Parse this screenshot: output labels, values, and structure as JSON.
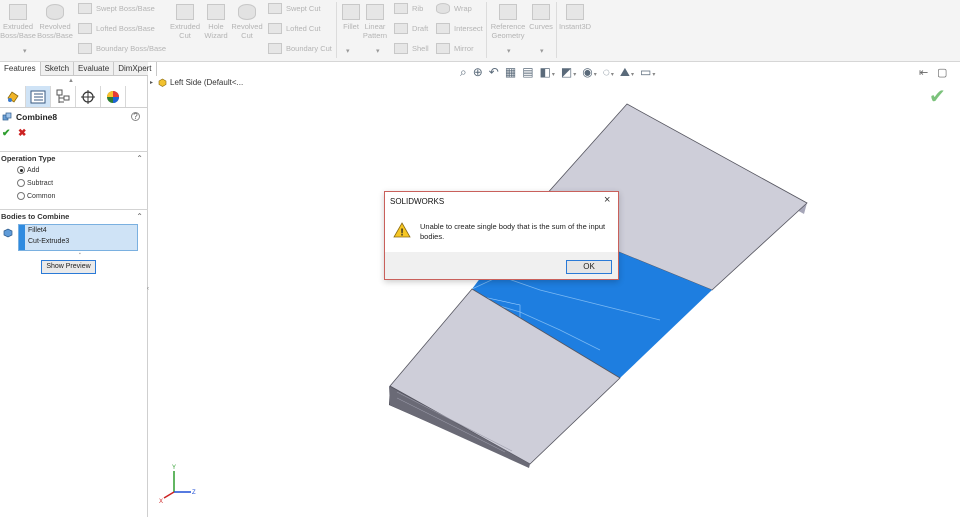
{
  "ribbon": {
    "extruded_boss": "Extruded\nBoss/Base",
    "revolved_boss": "Revolved\nBoss/Base",
    "swept_boss": "Swept Boss/Base",
    "lofted_boss": "Lofted Boss/Base",
    "boundary_boss": "Boundary Boss/Base",
    "extruded_cut": "Extruded\nCut",
    "hole_wizard": "Hole\nWizard",
    "revolved_cut": "Revolved\nCut",
    "swept_cut": "Swept Cut",
    "lofted_cut": "Lofted Cut",
    "boundary_cut": "Boundary Cut",
    "fillet": "Fillet",
    "linear_pattern": "Linear\nPattern",
    "rib": "Rib",
    "draft": "Draft",
    "shell": "Shell",
    "wrap": "Wrap",
    "intersect": "Intersect",
    "mirror": "Mirror",
    "reference_geometry": "Reference\nGeometry",
    "curves": "Curves",
    "instant3d": "Instant3D"
  },
  "tabs": [
    "Features",
    "Sketch",
    "Evaluate",
    "DimXpert"
  ],
  "tree": {
    "root_label": "Left Side  (Default<..."
  },
  "property_manager": {
    "title": "Combine8",
    "operation_type_label": "Operation Type",
    "operations": [
      "Add",
      "Subtract",
      "Common"
    ],
    "selected_operation": "Add",
    "bodies_label": "Bodies to Combine",
    "bodies": [
      "Fillet4",
      "Cut-Extrude3"
    ],
    "show_preview": "Show Preview"
  },
  "dialog": {
    "title": "SOLIDWORKS",
    "message": "Unable to create single body that is the sum of the input bodies.",
    "ok": "OK"
  },
  "triad": {
    "x": "X",
    "y": "Y",
    "z": "Z"
  },
  "colors": {
    "selection_blue": "#1e7ee0",
    "model_gray": "#c9c9d6",
    "accept_green": "#2e9e2e",
    "cancel_red": "#cc2222",
    "dialog_border": "#c9605b"
  }
}
